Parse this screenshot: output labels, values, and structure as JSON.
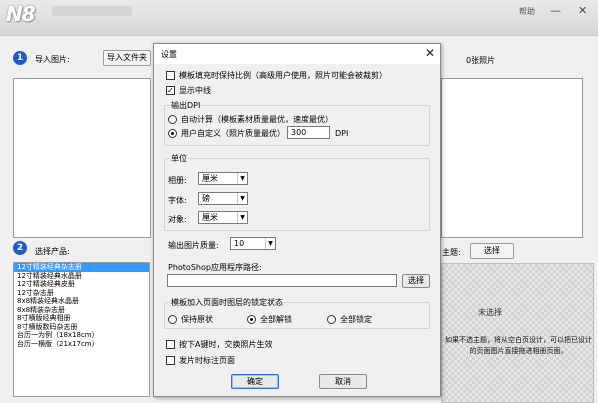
{
  "main": {
    "help_label": "帮助",
    "minimize_glyph": "—",
    "close_glyph": "✕",
    "step1_number": "1",
    "step1_label": "导入图片:",
    "import_folder_button": "导入文件夹",
    "photo_count": "0张照片",
    "step2_number": "2",
    "step2_label": "选择产品:",
    "theme_label": "主题:",
    "theme_select_button": "选择",
    "products": [
      "12寸精装经典杂志册",
      "12寸精装经典水晶册",
      "12寸精装经典皮册",
      "12寸杂志册",
      "8x8精装经典水晶册",
      "8x8精装杂志册",
      "8寸横版经典相册",
      "8寸横版数码杂志册",
      "台历一为例（18x18cm）",
      "台历一横版（21x17cm）"
    ],
    "selected_product_index": 0,
    "preview_label": "未选择",
    "preview_note": "如果不选主题，将从空白页设计，可以把已设计的页面图片直接拖进相册页面。"
  },
  "dialog": {
    "title": "设置",
    "close_glyph": "✕",
    "fit_ratio_label": "模板填充时保持比例（高级用户使用，照片可能会被裁剪）",
    "fit_ratio_checked": false,
    "show_centerline_label": "显示中线",
    "show_centerline_checked": true,
    "dpi_group_title": "输出DPI",
    "dpi_auto_label": "自动计算（模板素材质量最优，速度最优）",
    "dpi_custom_label": "用户自定义（照片质量最优）",
    "dpi_selected": "custom",
    "dpi_value": "300",
    "dpi_unit": "DPI",
    "unit_group_title": "单位",
    "album_unit_label": "相册:",
    "album_unit_value": "厘米",
    "font_unit_label": "字体:",
    "font_unit_value": "磅",
    "object_unit_label": "对象:",
    "object_unit_value": "厘米",
    "output_quality_label": "输出图片质量:",
    "output_quality_value": "10",
    "photoshop_path_label": "PhotoShop应用程序路径:",
    "photoshop_path_value": "",
    "browse_button": "选择",
    "lock_group_title": "模板加入页面时图层的锁定状态",
    "lock_keep_label": "保持原状",
    "lock_unlock_all_label": "全部解锁",
    "lock_lock_all_label": "全部锁定",
    "lock_selected": "unlock_all",
    "press_a_label": "按下A键时，交换照片生效",
    "press_a_checked": false,
    "mark_page_label": "发片时标注页面",
    "mark_page_checked": false,
    "ok_button": "确定",
    "cancel_button": "取消"
  }
}
